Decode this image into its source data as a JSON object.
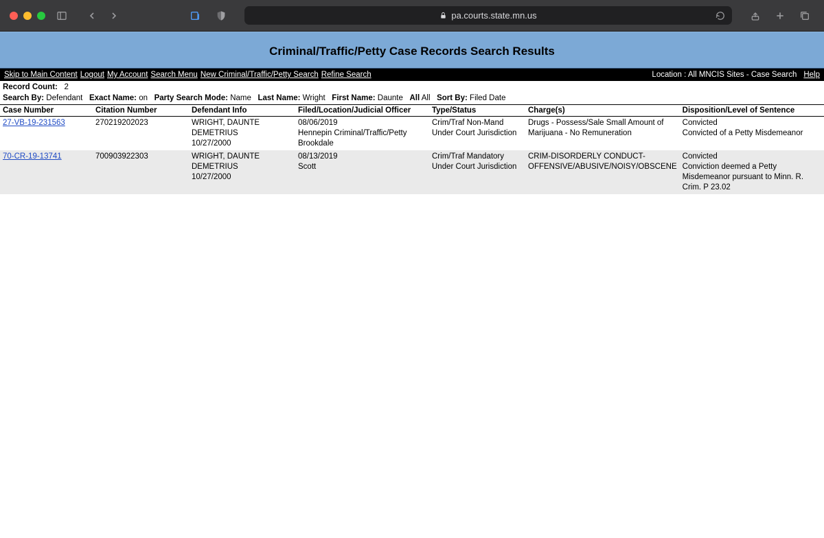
{
  "browser": {
    "url": "pa.courts.state.mn.us"
  },
  "page": {
    "title": "Criminal/Traffic/Petty Case Records Search Results"
  },
  "menubar": {
    "links": [
      "Skip to Main Content",
      "Logout",
      "My Account",
      "Search Menu",
      "New Criminal/Traffic/Petty Search",
      "Refine Search"
    ],
    "location_text": "Location : All MNCIS Sites - Case Search",
    "help_text": "Help"
  },
  "summary": {
    "record_count_label": "Record Count:",
    "record_count_value": "2",
    "search_by_label": "Search By:",
    "search_by_value": "Defendant",
    "exact_name_label": "Exact Name:",
    "exact_name_value": "on",
    "party_mode_label": "Party Search Mode:",
    "party_mode_value": "Name",
    "last_name_label": "Last Name:",
    "last_name_value": "Wright",
    "first_name_label": "First Name:",
    "first_name_value": "Daunte",
    "all_label": "All",
    "all_value": "All",
    "sort_by_label": "Sort By:",
    "sort_by_value": "Filed Date"
  },
  "columns": {
    "case": "Case Number",
    "citation": "Citation Number",
    "defendant": "Defendant Info",
    "filed": "Filed/Location/Judicial Officer",
    "type": "Type/Status",
    "charges": "Charge(s)",
    "disposition": "Disposition/Level of Sentence"
  },
  "rows": [
    {
      "case_number": "27-VB-19-231563",
      "citation": "270219202023",
      "defendant_l1": "WRIGHT, DAUNTE DEMETRIUS",
      "defendant_l2": "10/27/2000",
      "filed_l1": "08/06/2019",
      "filed_l2": "Hennepin Criminal/Traffic/Petty Brookdale",
      "type_l1": "Crim/Traf Non-Mand",
      "type_l2": "Under Court Jurisdiction",
      "charges": "Drugs - Possess/Sale Small Amount of Marijuana - No Remuneration",
      "disp_l1": "Convicted",
      "disp_l2": "Convicted of a Petty Misdemeanor"
    },
    {
      "case_number": "70-CR-19-13741",
      "citation": "700903922303",
      "defendant_l1": "WRIGHT, DAUNTE DEMETRIUS",
      "defendant_l2": "10/27/2000",
      "filed_l1": "08/13/2019",
      "filed_l2": "Scott",
      "type_l1": "Crim/Traf Mandatory",
      "type_l2": "Under Court Jurisdiction",
      "charges": "CRIM-DISORDERLY CONDUCT-OFFENSIVE/ABUSIVE/NOISY/OBSCENE",
      "disp_l1": "Convicted",
      "disp_l2": "Conviction deemed a Petty Misdemeanor pursuant to Minn. R. Crim. P 23.02"
    }
  ]
}
